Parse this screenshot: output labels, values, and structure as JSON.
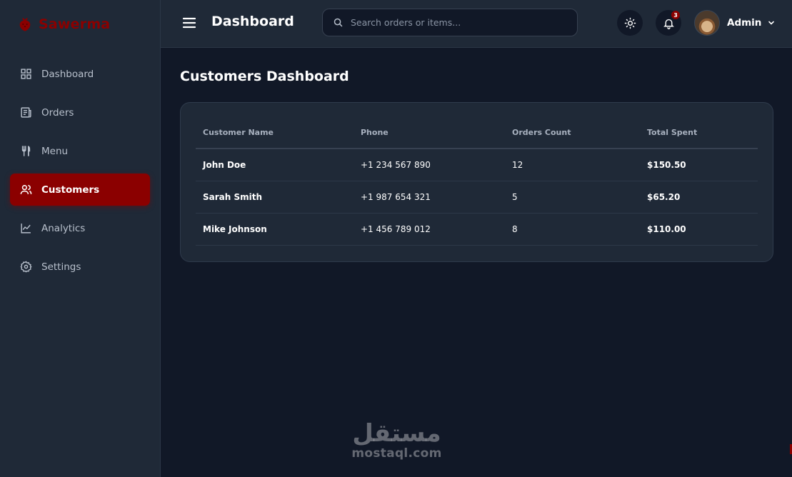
{
  "brand": {
    "name": "Sawerma",
    "color": "#8b0000"
  },
  "sidebar": {
    "items": [
      {
        "label": "Dashboard",
        "icon": "grid-icon",
        "active": false
      },
      {
        "label": "Orders",
        "icon": "receipt-icon",
        "active": false
      },
      {
        "label": "Menu",
        "icon": "utensils-icon",
        "active": false
      },
      {
        "label": "Customers",
        "icon": "users-icon",
        "active": true
      },
      {
        "label": "Analytics",
        "icon": "chart-line-icon",
        "active": false
      },
      {
        "label": "Settings",
        "icon": "gear-icon",
        "active": false
      }
    ]
  },
  "header": {
    "title": "Dashboard",
    "search_placeholder": "Search orders or items...",
    "notification_count": "3",
    "user_name": "Admin"
  },
  "main": {
    "title": "Customers Dashboard",
    "table": {
      "columns": [
        "Customer Name",
        "Phone",
        "Orders Count",
        "Total Spent"
      ],
      "rows": [
        [
          "John Doe",
          "+1 234 567 890",
          "12",
          "$150.50"
        ],
        [
          "Sarah Smith",
          "+1 987 654 321",
          "5",
          "$65.20"
        ],
        [
          "Mike Johnson",
          "+1 456 789 012",
          "8",
          "$110.00"
        ]
      ]
    }
  },
  "watermark": {
    "arabic": "مستقل",
    "latin": "mostaql.com"
  },
  "colors": {
    "accent": "#8b0000",
    "background": "#111827",
    "surface": "#1f2937"
  }
}
